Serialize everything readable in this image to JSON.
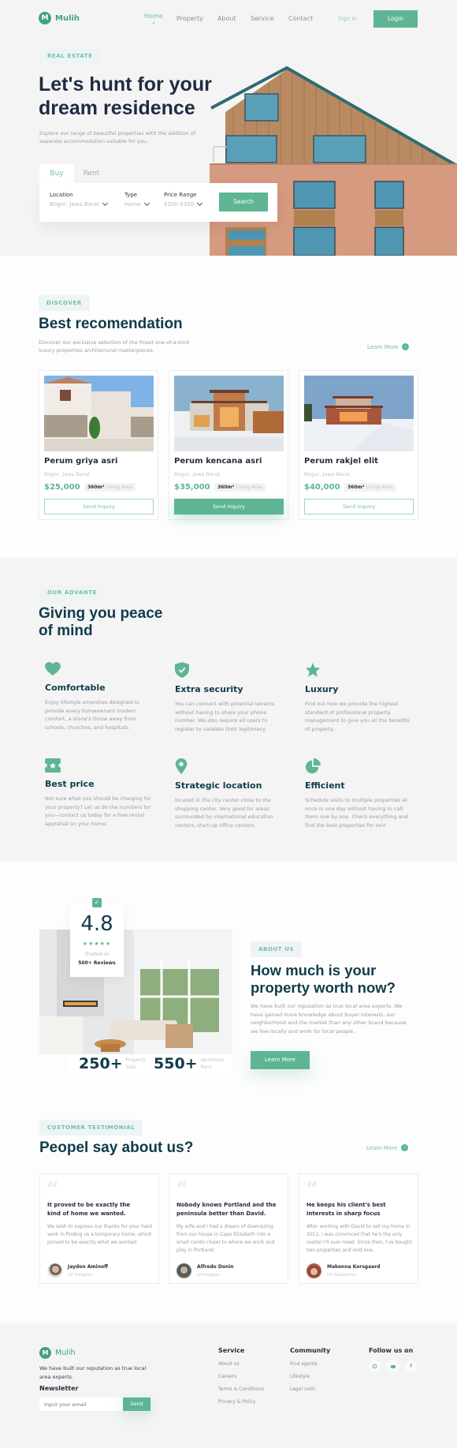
{
  "colors": {
    "accent": "#5db594",
    "heading": "#0f3c4a",
    "hero_heading": "#1f2a44",
    "bg_grey": "#f4f4f4",
    "text_muted": "#9a9ca3"
  },
  "nav": {
    "brand": "Mulih",
    "logo_letter": "M",
    "links": [
      {
        "label": "Home",
        "active": true
      },
      {
        "label": "Property"
      },
      {
        "label": "About"
      },
      {
        "label": "Service"
      },
      {
        "label": "Contact"
      }
    ],
    "sign_in": "Sign in",
    "login": "Login"
  },
  "hero": {
    "tag": "REAL ESTATE",
    "title_line1": "Let's hunt for your",
    "title_line2": "dream residence",
    "subtitle": "Explore our range of beautiful properties with the addition of separate accommodation suitable for you.",
    "tabs": [
      {
        "label": "Buy",
        "active": true
      },
      {
        "label": "Rent"
      }
    ],
    "fields": [
      {
        "label": "Location",
        "value": "Bogor, Jawa Barat"
      },
      {
        "label": "Type",
        "value": "Home"
      },
      {
        "label": "Price Range",
        "value": "$200-$350"
      }
    ],
    "search_button": "Search"
  },
  "recommendation": {
    "tag": "DISCOVER",
    "title": "Best recomendation",
    "subtitle": "Discover our exclusive selection of the finest one-of-a-kind luxury properties architectural masterpieces.",
    "learn_more": "Learn More",
    "cards": [
      {
        "name": "Perum griya asri",
        "location": "Bogor, Jawa Barat",
        "price": "$25,000",
        "area": "360m²",
        "area_label": "Living Area",
        "button": "Send Inquiry",
        "highlighted": false
      },
      {
        "name": "Perum kencana asri",
        "location": "Bogor, Jawa Barat",
        "price": "$35,000",
        "area": "360m²",
        "area_label": "Living Area",
        "button": "Send Inquiry",
        "highlighted": true
      },
      {
        "name": "Perum rakjel elit",
        "location": "Bogor, Jawa Barat",
        "price": "$40,000",
        "area": "360m²",
        "area_label": "Living Area",
        "button": "Send Inquiry",
        "highlighted": false
      }
    ]
  },
  "advantages": {
    "tag": "OUR ADVANTE",
    "title_line1": "Giving you peace",
    "title_line2": "of mind",
    "items": [
      {
        "icon": "heart-icon",
        "title": "Comfortable",
        "text": "Enjoy lifestyle amenities designed to provide every homeowners modern comfort, a stone's throw away from schools, churches, and hospitals."
      },
      {
        "icon": "shield-check-icon",
        "title": "Extra security",
        "text": "You can connect with potential tenants without having to share your phone number. We also require all users to register to validate their legitimacy."
      },
      {
        "icon": "star-icon",
        "title": "Luxury",
        "text": "Find out how we provide the highest standard of professional property management to give you all the benefits of property."
      },
      {
        "icon": "ticket-icon",
        "title": "Best price",
        "text": "Not sure what you should be charging for your property? Let us do the numbers for you—contact us today for a free rental appraisal on your home."
      },
      {
        "icon": "location-pin-icon",
        "title": "Strategic location",
        "text": "located in the city center close to the shopping center. Very good for areas surrounded by international education centers, start-up office centers."
      },
      {
        "icon": "pie-chart-icon",
        "title": "Efficient",
        "text": "Schedule visits to multiple properties at once in one day without having to call them one by one. Check everything and find the best properties for rent"
      }
    ]
  },
  "about": {
    "rating": "4.8",
    "stars": 5,
    "trusted_on": "Trusted on",
    "reviews": "500+ Reviews",
    "stat1_value": "250+",
    "stat1_label_line1": "Property",
    "stat1_label_line2": "Sale",
    "stat2_value": "550+",
    "stat2_label_line1": "Apartmen",
    "stat2_label_line2": "Rent",
    "tag": "ABOUT US",
    "title_line1": "How much is your",
    "title_line2": "property worth now?",
    "text": "We have built our reputation as true local area experts. We have gained more knowledge about buyer interests, our neighborhood and the market than any other brand because we live locally and work for local people.",
    "button": "Learn More"
  },
  "testimonials": {
    "tag": "CUSTOMER TESTIMONIAL",
    "title": "Peopel say about us?",
    "learn_more": "Learn More",
    "items": [
      {
        "headline": "It proved to be exactly the kind of home we wanted.",
        "text": "We wish to express our thanks for your hard work in finding us a temporary home, which proved to be exactly what we wanted.",
        "name": "Jaydon Aminoff",
        "role": "UX Designer"
      },
      {
        "headline": "Nobody knows Portland and the peninsula better than David.",
        "text": "My wife and I had a dream of downsizing from our house in Cape Elizabeth into a small condo closer to where we work and play in Portland.",
        "name": "Alfredo Donin",
        "role": "UI Designer"
      },
      {
        "headline": "He keeps his client's best interests in sharp focus",
        "text": "After working with David to sell my home in 2013, I was convinced that he's the only realtor I'll ever need. Since then, I've bought two properties and sold one.",
        "name": "Makenna Korsgaard",
        "role": "UX Researcher"
      }
    ]
  },
  "footer": {
    "brand": "Mulih",
    "logo_letter": "M",
    "about_text": "We have built our reputation as true local area experts.",
    "newsletter_title": "Newsletter",
    "email_placeholder": "Input your email",
    "send_button": "Send",
    "service_title": "Service",
    "service_links": [
      "About us",
      "Careers",
      "Terms & Conditions",
      "Privacy & Policy"
    ],
    "community_title": "Community",
    "community_links": [
      "Find agents",
      "Lifestyle",
      "Legal notic"
    ],
    "follow_title": "Follow us on",
    "socials": [
      "instagram-icon",
      "youtube-icon",
      "facebook-icon"
    ]
  }
}
